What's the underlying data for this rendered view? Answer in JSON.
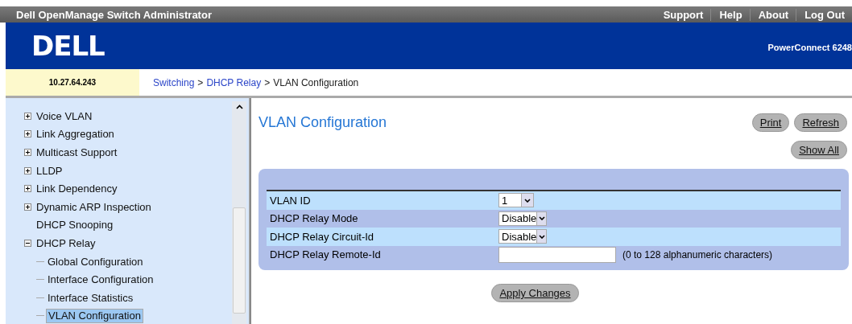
{
  "window": {
    "title": "Dell OpenManage Switch Administrator"
  },
  "top_links": [
    "Support",
    "Help",
    "About",
    "Log Out"
  ],
  "banner": {
    "logo": "DELL",
    "product": "PowerConnect 6248"
  },
  "address": "10.27.64.243",
  "breadcrumb": [
    {
      "kind": "link",
      "label": "Switching"
    },
    {
      "kind": "separator",
      "label": ">"
    },
    {
      "kind": "link",
      "label": "DHCP Relay"
    },
    {
      "kind": "separator",
      "label": ">"
    },
    {
      "kind": "current",
      "label": "VLAN Configuration"
    }
  ],
  "sidebar": {
    "items": [
      {
        "label": "Voice VLAN",
        "kind": "folder",
        "expanded": false,
        "selected": false
      },
      {
        "label": "Link Aggregation",
        "kind": "folder",
        "expanded": false,
        "selected": false
      },
      {
        "label": "Multicast Support",
        "kind": "folder",
        "expanded": false,
        "selected": false
      },
      {
        "label": "LLDP",
        "kind": "folder",
        "expanded": false,
        "selected": false
      },
      {
        "label": "Link Dependency",
        "kind": "folder",
        "expanded": false,
        "selected": false
      },
      {
        "label": "Dynamic ARP Inspection",
        "kind": "folder",
        "expanded": false,
        "selected": false
      },
      {
        "label": "DHCP Snooping",
        "kind": "leaf",
        "selected": false
      },
      {
        "label": "DHCP Relay",
        "kind": "folder",
        "expanded": true,
        "selected": false,
        "children": [
          {
            "label": "Global Configuration",
            "selected": false
          },
          {
            "label": "Interface Configuration",
            "selected": false
          },
          {
            "label": "Interface Statistics",
            "selected": false
          },
          {
            "label": "VLAN Configuration",
            "selected": true
          }
        ]
      }
    ]
  },
  "page": {
    "title": "VLAN Configuration",
    "buttons": [
      "Print",
      "Refresh"
    ],
    "show_all": "Show All",
    "fields": [
      {
        "label": "VLAN ID",
        "kind": "select",
        "value": "1"
      },
      {
        "label": "DHCP Relay Mode",
        "kind": "select",
        "value": "Disable"
      },
      {
        "label": "DHCP Relay Circuit-Id",
        "kind": "select",
        "value": "Disable"
      },
      {
        "label": "DHCP Relay Remote-Id",
        "kind": "text",
        "hint": "(0 to 128 alphanumeric characters)"
      }
    ],
    "apply": "Apply Changes"
  }
}
